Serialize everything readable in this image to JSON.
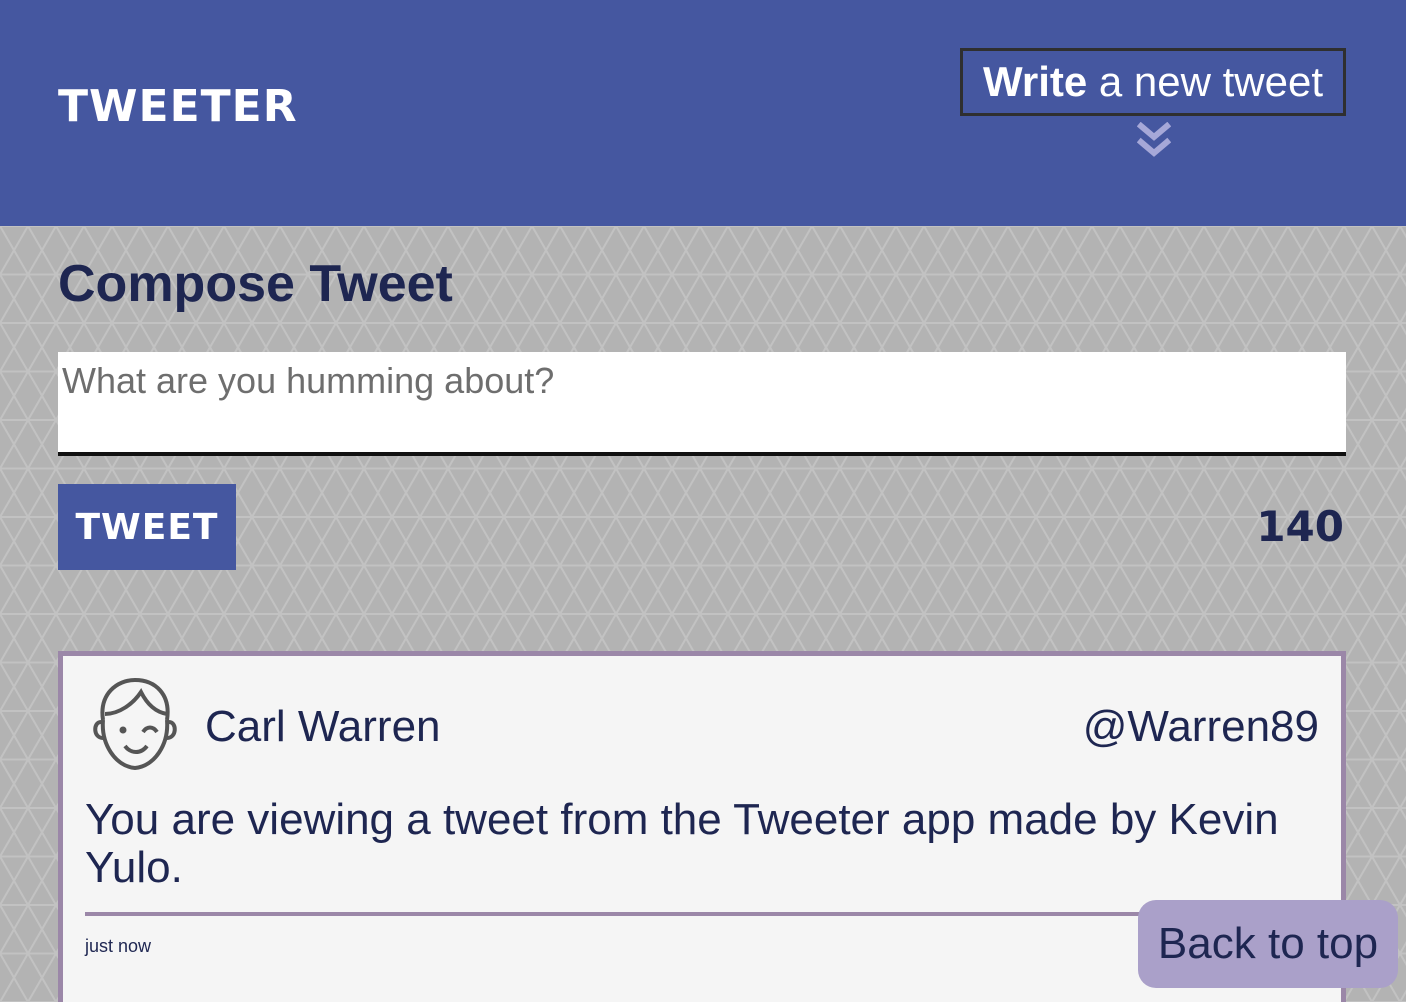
{
  "navbar": {
    "logo": "TWEETER",
    "write_bold": "Write",
    "write_rest": " a new tweet",
    "chevron_icon": "double-chevron-down-icon"
  },
  "compose": {
    "title": "Compose Tweet",
    "placeholder": "What are you humming about?",
    "button_label": "TWEET",
    "counter": "140"
  },
  "tweet": {
    "avatar_icon": "face-avatar-icon",
    "name": "Carl Warren",
    "handle": "@Warren89",
    "text": "You are viewing a tweet from the Tweeter app made by Kevin Yulo.",
    "time": "just now"
  },
  "back_to_top": "Back to top",
  "colors": {
    "navbar": "#4557a0",
    "accent_purple": "#9b87a8",
    "back_to_top_bg": "#aaa0c9",
    "text_dark": "#1e2651",
    "page_bg": "#b3b3b3"
  }
}
